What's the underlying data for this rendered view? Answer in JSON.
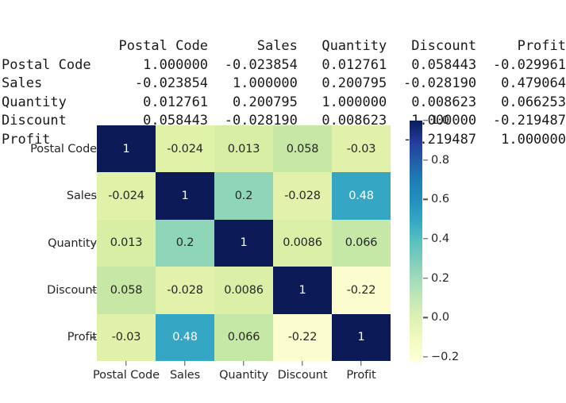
{
  "dataframe": {
    "columns": [
      "Postal Code",
      "Sales",
      "Quantity",
      "Discount",
      "Profit"
    ],
    "index": [
      "Postal Code",
      "Sales",
      "Quantity",
      "Discount",
      "Profit"
    ],
    "rows": [
      [
        "1.000000",
        "-0.023854",
        "0.012761",
        "0.058443",
        "-0.029961"
      ],
      [
        "-0.023854",
        "1.000000",
        "0.200795",
        "-0.028190",
        "0.479064"
      ],
      [
        "0.012761",
        "0.200795",
        "1.000000",
        "0.008623",
        "0.066253"
      ],
      [
        "0.058443",
        "-0.028190",
        "0.008623",
        "1.000000",
        "-0.219487"
      ],
      [
        "-0.029961",
        "0.479064",
        "0.066253",
        "-0.219487",
        "1.000000"
      ]
    ]
  },
  "chart_data": {
    "type": "heatmap",
    "title": "",
    "xlabel": "",
    "ylabel": "",
    "colormap": "YlGnBu",
    "annotated": true,
    "grid": false,
    "legend_position": "right",
    "x_categories": [
      "Postal Code",
      "Sales",
      "Quantity",
      "Discount",
      "Profit"
    ],
    "y_categories": [
      "Postal Code",
      "Sales",
      "Quantity",
      "Discount",
      "Profit"
    ],
    "values": [
      [
        1,
        -0.023854,
        0.012761,
        0.058443,
        -0.029961
      ],
      [
        -0.023854,
        1,
        0.200795,
        -0.02819,
        0.479064
      ],
      [
        0.012761,
        0.200795,
        1,
        0.008623,
        0.066253
      ],
      [
        0.058443,
        -0.02819,
        0.008623,
        1,
        -0.219487
      ],
      [
        -0.029961,
        0.479064,
        0.066253,
        -0.219487,
        1
      ]
    ],
    "annotations": [
      [
        "1",
        "-0.024",
        "0.013",
        "0.058",
        "-0.03"
      ],
      [
        "-0.024",
        "1",
        "0.2",
        "-0.028",
        "0.48"
      ],
      [
        "0.013",
        "0.2",
        "1",
        "0.0086",
        "0.066"
      ],
      [
        "0.058",
        "-0.028",
        "0.0086",
        "1",
        "-0.22"
      ],
      [
        "-0.03",
        "0.48",
        "0.066",
        "-0.22",
        "1"
      ]
    ],
    "cell_colors": [
      [
        "#0c1a58",
        "#e0f1a8",
        "#d7eea4",
        "#c7e8a5",
        "#e1f1a9"
      ],
      [
        "#e0f1a8",
        "#0c1a58",
        "#8fd5b8",
        "#e3f2aa",
        "#35a7c4"
      ],
      [
        "#d7eea4",
        "#8fd5b8",
        "#0c1a58",
        "#dcefa6",
        "#c6e8a6"
      ],
      [
        "#c7e8a5",
        "#e3f2aa",
        "#dcefa6",
        "#0c1a58",
        "#fcfdcf"
      ],
      [
        "#e1f1a9",
        "#35a7c4",
        "#c6e8a6",
        "#fcfdcf",
        "#0c1a58"
      ]
    ],
    "text_colors": [
      [
        "#ffffff",
        "#262626",
        "#262626",
        "#262626",
        "#262626"
      ],
      [
        "#262626",
        "#ffffff",
        "#262626",
        "#262626",
        "#ffffff"
      ],
      [
        "#262626",
        "#262626",
        "#ffffff",
        "#262626",
        "#262626"
      ],
      [
        "#262626",
        "#262626",
        "#262626",
        "#ffffff",
        "#262626"
      ],
      [
        "#262626",
        "#ffffff",
        "#262626",
        "#262626",
        "#ffffff"
      ]
    ],
    "colorbar": {
      "vmin": -0.22,
      "vmax": 1.0,
      "ticks": [
        "1.0",
        "0.8",
        "0.6",
        "0.4",
        "0.2",
        "0.0",
        "−0.2"
      ],
      "tick_values": [
        1.0,
        0.8,
        0.6,
        0.4,
        0.2,
        0.0,
        -0.2
      ]
    }
  }
}
